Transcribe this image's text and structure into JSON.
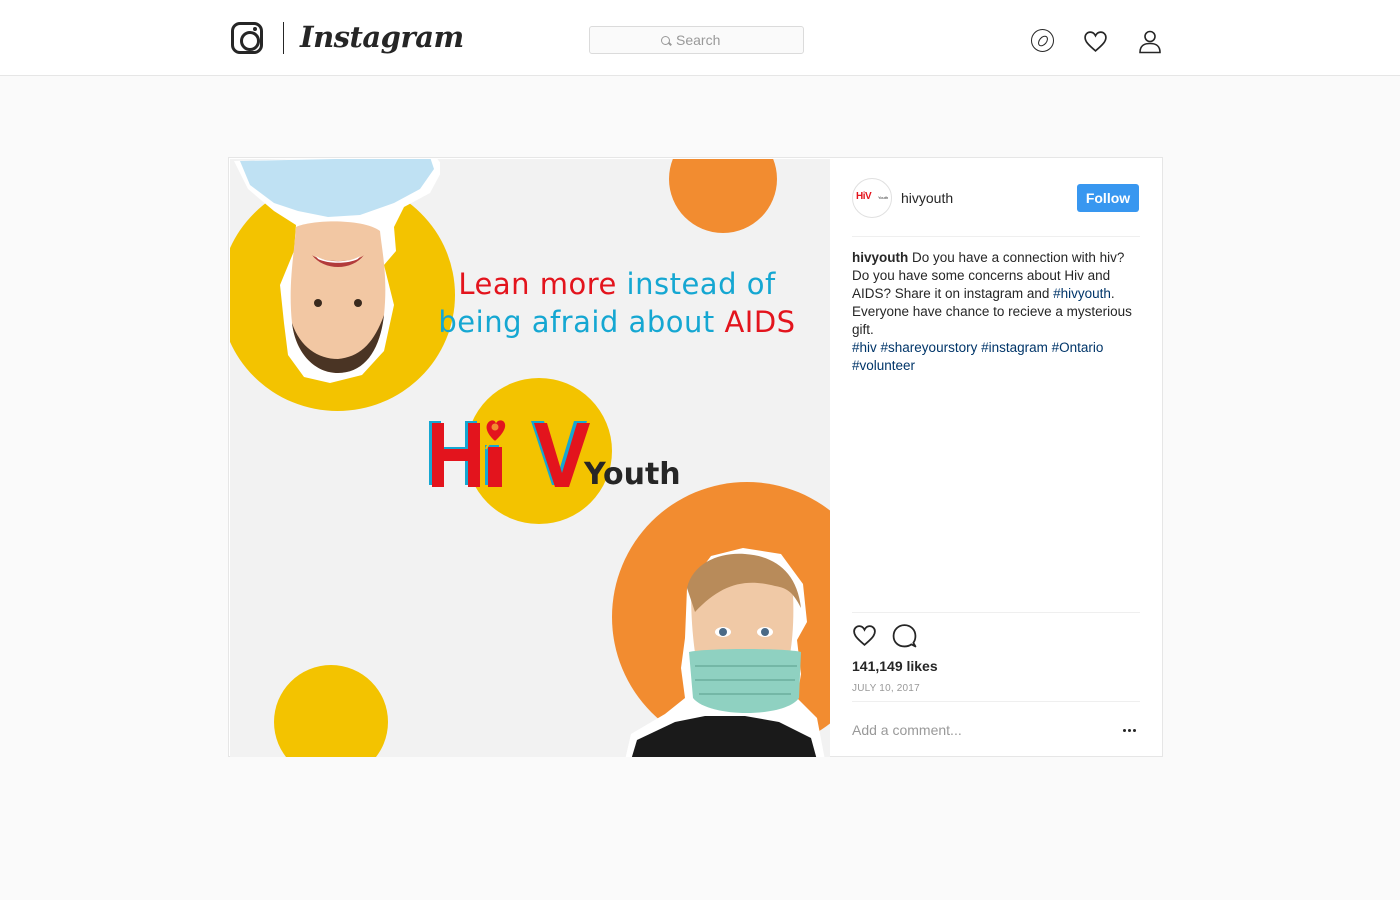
{
  "app": {
    "wordmark": "Instagram"
  },
  "search": {
    "placeholder": "Search"
  },
  "nav": {
    "icons": [
      "compass-icon",
      "heart-icon",
      "profile-icon"
    ]
  },
  "post": {
    "image": {
      "headline_part1": "Lean more",
      "headline_part2": "instead of being afraid about",
      "headline_part3": "AIDS",
      "brand_letters": "HIV",
      "brand_sub": "Youth"
    },
    "author": {
      "username": "hivyouth",
      "avatar_text": "HiV",
      "avatar_sub": "Youth",
      "follow_label": "Follow"
    },
    "caption": {
      "user": "hivyouth",
      "text": "Do you have a connection with hiv? Do you have some concerns about Hiv and AIDS? Share it on instagram and",
      "inline_tag": "#hivyouth",
      "text2": ". Everyone have chance to recieve a mysterious gift.",
      "tags": [
        "#hiv",
        "#shareyourstory",
        "#instagram",
        "#Ontario",
        "#volunteer"
      ]
    },
    "likes": "141,149 likes",
    "date": "JULY 10, 2017",
    "comment_placeholder": "Add a comment..."
  },
  "colors": {
    "accent": "#3897f0",
    "brand_red": "#e3141d",
    "brand_blue": "#15a7d2",
    "yellow": "#f3c300",
    "orange": "#f28c30"
  }
}
